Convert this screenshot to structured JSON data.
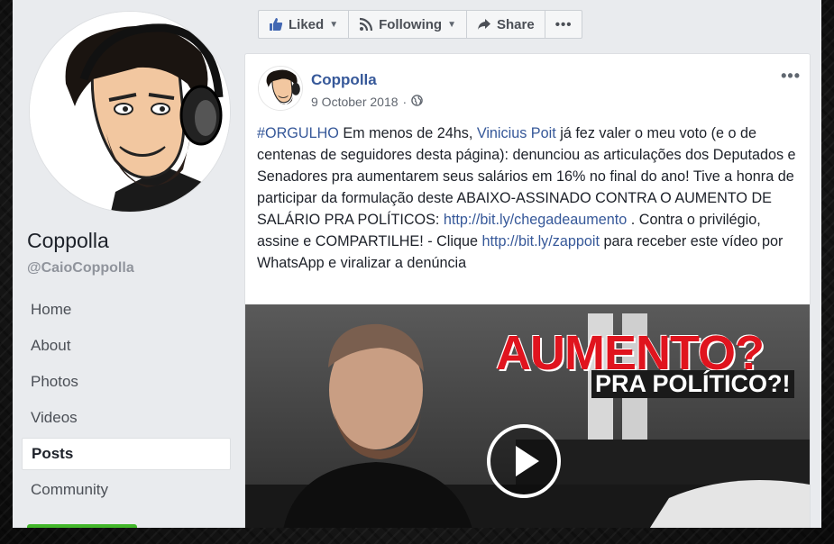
{
  "page": {
    "name": "Coppolla",
    "handle": "@CaioCoppolla"
  },
  "nav": {
    "items": [
      {
        "label": "Home",
        "active": false
      },
      {
        "label": "About",
        "active": false
      },
      {
        "label": "Photos",
        "active": false
      },
      {
        "label": "Videos",
        "active": false
      },
      {
        "label": "Posts",
        "active": true
      },
      {
        "label": "Community",
        "active": false
      }
    ]
  },
  "actions": {
    "liked": "Liked",
    "following": "Following",
    "share": "Share",
    "more": "•••"
  },
  "post": {
    "author": "Coppolla",
    "date": "9 October 2018",
    "menu": "•••",
    "text": {
      "hashtag": "#ORGULHO",
      "t1": " Em menos de 24hs, ",
      "mention": "Vinicius Poit",
      "t2": " já fez valer o meu voto (e o de centenas de seguidores desta página): denunciou as articulações dos Deputados e Senadores pra aumentarem seus salários em 16% no final do ano! Tive a honra de participar da formulação deste ABAIXO-ASSINADO CONTRA O AUMENTO DE SALÁRIO PRA POLÍTICOS: ",
      "link1": "http://bit.ly/chegadeaumento",
      "t3": " . Contra o privilégio, assine e COMPARTILHE! - Clique ",
      "link2": "http://bit.ly/zappoit",
      "t4": " para receber este vídeo por WhatsApp e viralizar a denúncia"
    },
    "video": {
      "headline": "AUMENTO?",
      "subheadline": "PRA POLÍTICO?!"
    }
  },
  "colors": {
    "link": "#365899",
    "headline_red": "#e0141e",
    "fb_bg": "#e9ebee"
  }
}
